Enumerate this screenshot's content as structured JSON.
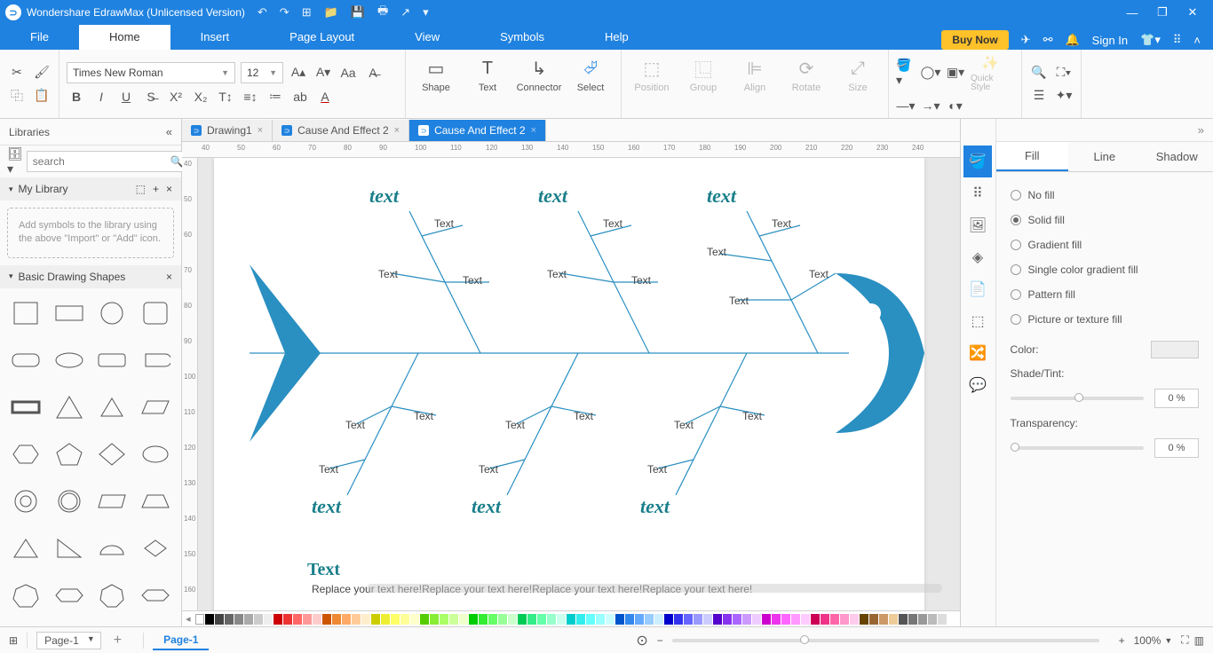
{
  "app": {
    "title": "Wondershare EdrawMax (Unlicensed Version)"
  },
  "menu": {
    "tabs": [
      "File",
      "Home",
      "Insert",
      "Page Layout",
      "View",
      "Symbols",
      "Help"
    ],
    "active": 1,
    "buyNow": "Buy Now",
    "signIn": "Sign In"
  },
  "ribbon": {
    "font": "Times New Roman",
    "size": "12",
    "shape": "Shape",
    "text": "Text",
    "connector": "Connector",
    "select": "Select",
    "position": "Position",
    "group": "Group",
    "align": "Align",
    "rotate": "Rotate",
    "sizeLbl": "Size",
    "quickStyle": "Quick\nStyle"
  },
  "libraries": {
    "title": "Libraries",
    "searchPlaceholder": "search",
    "myLibrary": "My Library",
    "hint": "Add symbols to the library using the above \"Import\" or \"Add\" icon.",
    "basicShapes": "Basic Drawing Shapes"
  },
  "docTabs": [
    {
      "label": "Drawing1",
      "active": false
    },
    {
      "label": "Cause And Effect 2",
      "active": false
    },
    {
      "label": "Cause And Effect 2",
      "active": true
    }
  ],
  "rulerH": [
    "40",
    "50",
    "60",
    "70",
    "80",
    "90",
    "100",
    "110",
    "120",
    "130",
    "140",
    "150",
    "160",
    "170",
    "180",
    "190",
    "200",
    "210",
    "220",
    "230",
    "240"
  ],
  "rulerV": [
    "40",
    "50",
    "60",
    "70",
    "80",
    "90",
    "100",
    "110",
    "120",
    "130",
    "140",
    "150",
    "160"
  ],
  "diagram": {
    "topCats": [
      "text",
      "text",
      "text"
    ],
    "botCats": [
      "text",
      "text",
      "text"
    ],
    "sub": "Text",
    "footerTitle": "Text",
    "footerBody": "Replace your text here!Replace your text here!Replace your text here!Replace your text here!"
  },
  "rightPanel": {
    "tabs": [
      "Fill",
      "Line",
      "Shadow"
    ],
    "activeTab": 0,
    "fillOptions": [
      "No fill",
      "Solid fill",
      "Gradient fill",
      "Single color gradient fill",
      "Pattern fill",
      "Picture or texture fill"
    ],
    "fillSelected": 1,
    "color": "Color:",
    "shade": "Shade/Tint:",
    "transparency": "Transparency:",
    "pct": "0 %"
  },
  "status": {
    "pageSel": "Page-1",
    "pageTab": "Page-1",
    "zoom": "100%"
  },
  "palette": [
    "#000",
    "#444",
    "#666",
    "#888",
    "#aaa",
    "#ccc",
    "#eee",
    "#c00",
    "#e33",
    "#f66",
    "#f99",
    "#fcc",
    "#c50",
    "#e83",
    "#fa6",
    "#fc9",
    "#fec",
    "#cc0",
    "#ee3",
    "#ff6",
    "#ff9",
    "#ffc",
    "#5c0",
    "#8e3",
    "#af6",
    "#cf9",
    "#efc",
    "#0c0",
    "#3e3",
    "#6f6",
    "#9f9",
    "#cfc",
    "#0c5",
    "#3e8",
    "#6fa",
    "#9fc",
    "#cfe",
    "#0cc",
    "#3ee",
    "#6ff",
    "#9ff",
    "#cff",
    "#05c",
    "#38e",
    "#6af",
    "#9cf",
    "#cef",
    "#00c",
    "#33e",
    "#66f",
    "#99f",
    "#ccf",
    "#50c",
    "#83e",
    "#a6f",
    "#c9f",
    "#ecf",
    "#c0c",
    "#e3e",
    "#f6f",
    "#f9f",
    "#fcf",
    "#c05",
    "#e38",
    "#f6a",
    "#f9c",
    "#fce",
    "#640",
    "#963",
    "#c96",
    "#ec9",
    "#555",
    "#777",
    "#999",
    "#bbb",
    "#ddd",
    "#fff"
  ]
}
